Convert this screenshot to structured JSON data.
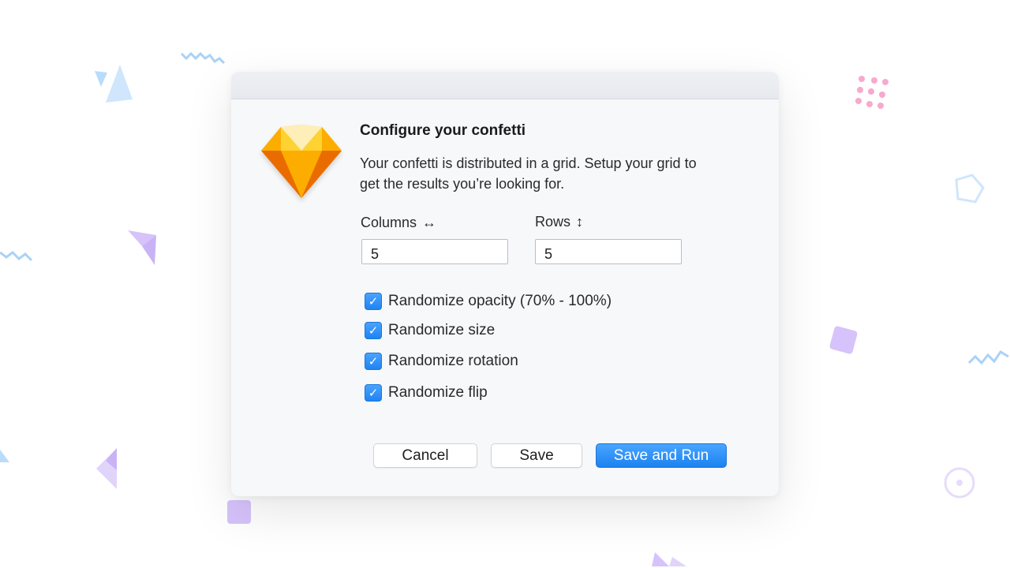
{
  "dialog": {
    "title": "Configure your confetti",
    "description": "Your confetti is distributed in a grid. Setup your grid to get the results you’re looking for.",
    "icon": "sketch-diamond-icon",
    "fields": {
      "columns": {
        "label": "Columns",
        "arrow": "↔",
        "value": "5"
      },
      "rows": {
        "label": "Rows",
        "arrow": "↕",
        "value": "5"
      }
    },
    "options": [
      {
        "label": "Randomize opacity (70% - 100%)",
        "checked": true
      },
      {
        "label": "Randomize size",
        "checked": true
      },
      {
        "label": "Randomize rotation",
        "checked": true
      },
      {
        "label": "Randomize flip",
        "checked": true
      }
    ],
    "buttons": {
      "cancel": "Cancel",
      "save": "Save",
      "save_and_run": "Save and Run"
    },
    "check_glyph": "✓"
  },
  "colors": {
    "accent": "#1f84f2",
    "confetti_blue": "#b9dcfb",
    "confetti_purple": "#d6c3fb",
    "confetti_pink": "#f7a9cf"
  }
}
